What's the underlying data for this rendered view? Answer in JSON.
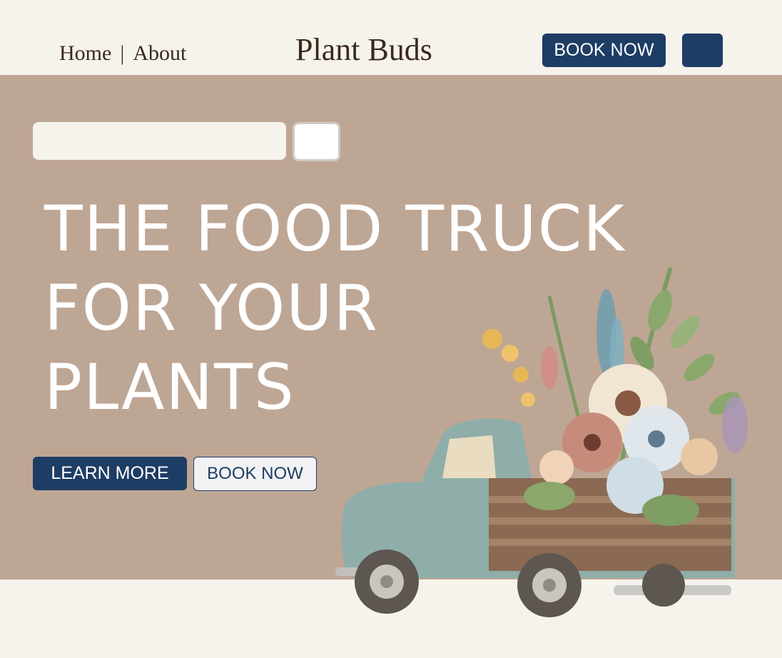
{
  "header": {
    "nav": {
      "home": "Home",
      "separator": "|",
      "about": "About"
    },
    "brand": "Plant Buds",
    "book_now": "BOOK NOW"
  },
  "hero": {
    "search": {
      "placeholder": ""
    },
    "headline": [
      "THE FOOD TRUCK",
      "FOR YOUR",
      "PLANTS"
    ],
    "learn_more": "LEARN MORE",
    "book_now": "BOOK NOW",
    "illustration_icon": "flower-truck-illustration"
  },
  "colors": {
    "background": "#f6f3ed",
    "hero": "#bea695",
    "accent": "#1e3d64",
    "text_dark": "#3a2a1c"
  }
}
